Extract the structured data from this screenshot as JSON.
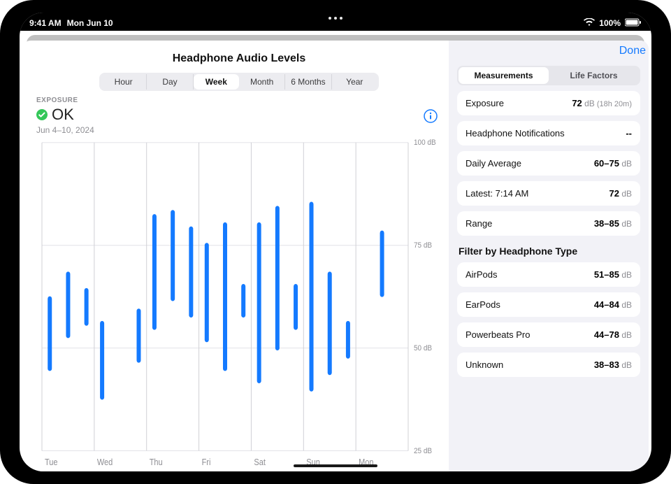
{
  "statusbar": {
    "time": "9:41 AM",
    "date": "Mon Jun 10",
    "battery": "100%"
  },
  "header": {
    "title": "Headphone Audio Levels",
    "done": "Done"
  },
  "segments": {
    "items": [
      "Hour",
      "Day",
      "Week",
      "Month",
      "6 Months",
      "Year"
    ],
    "selected": 2
  },
  "summary": {
    "caption": "EXPOSURE",
    "status": "OK",
    "range": "Jun 4–10, 2024"
  },
  "side": {
    "tabs": {
      "items": [
        "Measurements",
        "Life Factors"
      ],
      "selected": 0
    },
    "rows": [
      {
        "label": "Exposure",
        "value": "72",
        "unit": "dB",
        "sub": "(18h 20m)"
      },
      {
        "label": "Headphone Notifications",
        "value": "--",
        "unit": "",
        "sub": ""
      },
      {
        "label": "Daily Average",
        "value": "60–75",
        "unit": "dB",
        "sub": ""
      },
      {
        "label": "Latest: 7:14 AM",
        "value": "72",
        "unit": "dB",
        "sub": ""
      },
      {
        "label": "Range",
        "value": "38–85",
        "unit": "dB",
        "sub": ""
      }
    ],
    "filter_title": "Filter by Headphone Type",
    "filters": [
      {
        "label": "AirPods",
        "value": "51–85",
        "unit": "dB"
      },
      {
        "label": "EarPods",
        "value": "44–84",
        "unit": "dB"
      },
      {
        "label": "Powerbeats Pro",
        "value": "44–78",
        "unit": "dB"
      },
      {
        "label": "Unknown",
        "value": "38–83",
        "unit": "dB"
      }
    ]
  },
  "chart_data": {
    "type": "bar",
    "title": "Headphone Audio Levels — Exposure (Week)",
    "ylabel": "dB",
    "ylim": [
      25,
      100
    ],
    "yticks": [
      25,
      50,
      75,
      100
    ],
    "categories": [
      "Tue",
      "Wed",
      "Thu",
      "Fri",
      "Sat",
      "Sun",
      "Mon"
    ],
    "series": [
      {
        "name": "range",
        "values": [
          {
            "x": "Tue",
            "sub": 0,
            "lo": 45,
            "hi": 62
          },
          {
            "x": "Tue",
            "sub": 1,
            "lo": 53,
            "hi": 68
          },
          {
            "x": "Tue",
            "sub": 2,
            "lo": 56,
            "hi": 64
          },
          {
            "x": "Wed",
            "sub": 0,
            "lo": 38,
            "hi": 56
          },
          {
            "x": "Wed",
            "sub": 1,
            "lo": 47,
            "hi": 59
          },
          {
            "x": "Thu",
            "sub": 0,
            "lo": 55,
            "hi": 82
          },
          {
            "x": "Thu",
            "sub": 1,
            "lo": 62,
            "hi": 83
          },
          {
            "x": "Thu",
            "sub": 2,
            "lo": 58,
            "hi": 79
          },
          {
            "x": "Fri",
            "sub": 0,
            "lo": 52,
            "hi": 75
          },
          {
            "x": "Fri",
            "sub": 1,
            "lo": 45,
            "hi": 80
          },
          {
            "x": "Fri",
            "sub": 2,
            "lo": 58,
            "hi": 65
          },
          {
            "x": "Sat",
            "sub": 0,
            "lo": 42,
            "hi": 80
          },
          {
            "x": "Sat",
            "sub": 1,
            "lo": 50,
            "hi": 84
          },
          {
            "x": "Sat",
            "sub": 2,
            "lo": 55,
            "hi": 65
          },
          {
            "x": "Sun",
            "sub": 0,
            "lo": 40,
            "hi": 85
          },
          {
            "x": "Sun",
            "sub": 1,
            "lo": 44,
            "hi": 68
          },
          {
            "x": "Sun",
            "sub": 2,
            "lo": 48,
            "hi": 56
          },
          {
            "x": "Mon",
            "sub": 0,
            "lo": 63,
            "hi": 78
          }
        ]
      }
    ]
  }
}
